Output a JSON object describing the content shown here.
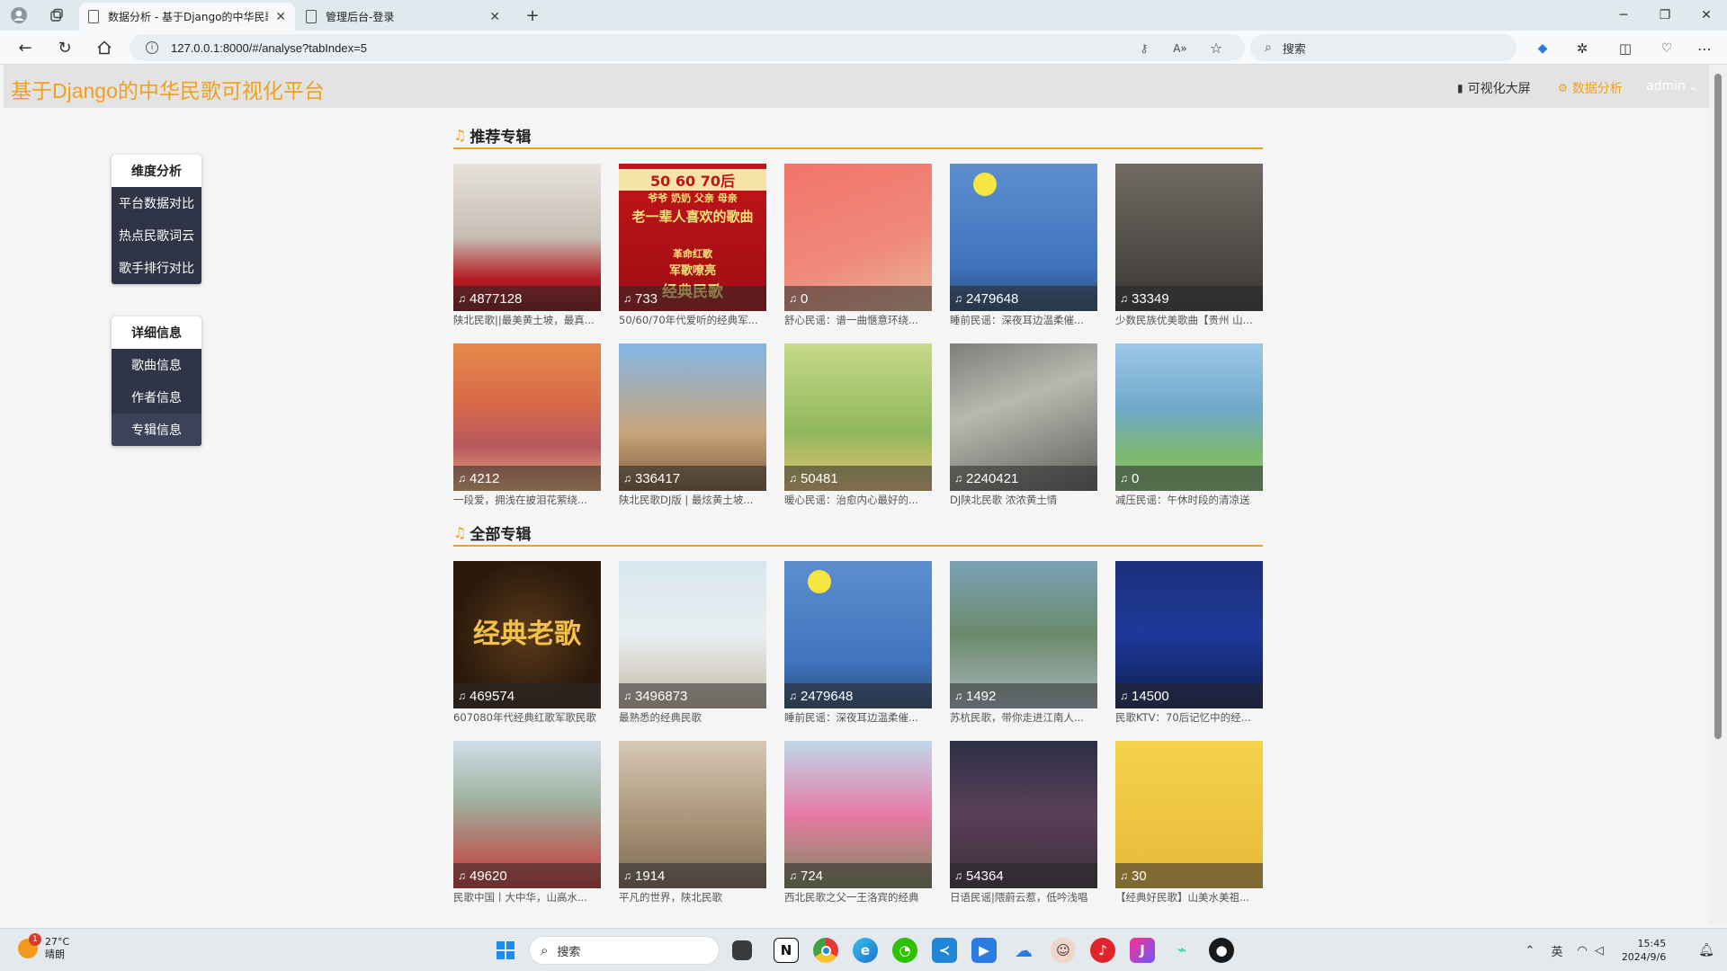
{
  "browser": {
    "tabs": [
      {
        "label": "数据分析 - 基于Django的中华民歌",
        "active": true
      },
      {
        "label": "管理后台-登录",
        "active": false
      }
    ],
    "new_tab": "+",
    "url": "127.0.0.1:8000/#/analyse?tabIndex=5",
    "search_placeholder": "搜索",
    "window_controls": [
      "minimize-icon",
      "restore-icon",
      "close-icon"
    ]
  },
  "header": {
    "site_title": "基于Django的中华民歌可视化平台",
    "links": [
      {
        "label": "可视化大屏",
        "icon": "bar-chart-icon"
      },
      {
        "label": "数据分析",
        "icon": "gear-icon",
        "active": true
      },
      {
        "label": "admin",
        "icon": "chevron-down-icon"
      }
    ]
  },
  "sidebar": {
    "dimension": {
      "title": "维度分析",
      "items": [
        "平台数据对比",
        "热点民歌词云",
        "歌手排行对比"
      ]
    },
    "detail": {
      "title": "详细信息",
      "items": [
        "歌曲信息",
        "作者信息",
        "专辑信息"
      ],
      "active_index": 2
    }
  },
  "sections": {
    "recommended": {
      "title": "推荐专辑",
      "albums": [
        {
          "count": "4877128",
          "title": "陕北民歌||最美黄土坡，最真..."
        },
        {
          "count": "733",
          "title": "50/60/70年代爱听的经典军..."
        },
        {
          "count": "0",
          "title": "舒心民谣：谱一曲惬意环绕..."
        },
        {
          "count": "2479648",
          "title": "睡前民谣：深夜耳边温柔催..."
        },
        {
          "count": "33349",
          "title": "少数民族优美歌曲【贵州 山..."
        },
        {
          "count": "4212",
          "title": "一段爱，拥浅在披泪花萦绕..."
        },
        {
          "count": "336417",
          "title": "陕北民歌DJ版 | 最炫黄土坡..."
        },
        {
          "count": "50481",
          "title": "暖心民谣：治愈内心最好的..."
        },
        {
          "count": "2240421",
          "title": "DJ陕北民歌 浓浓黄土情"
        },
        {
          "count": "0",
          "title": "减压民谣：午休时段的清凉送"
        }
      ]
    },
    "all": {
      "title": "全部专辑",
      "albums": [
        {
          "count": "469574",
          "title": "607080年代经典红歌军歌民歌"
        },
        {
          "count": "3496873",
          "title": "最熟悉的经典民歌"
        },
        {
          "count": "2479648",
          "title": "睡前民谣：深夜耳边温柔催..."
        },
        {
          "count": "1492",
          "title": "苏杭民歌，带你走进江南人..."
        },
        {
          "count": "14500",
          "title": "民歌KTV：70后记忆中的经..."
        },
        {
          "count": "49620",
          "title": "民歌中国丨大中华，山高水..."
        },
        {
          "count": "1914",
          "title": "平凡的世界，陕北民歌"
        },
        {
          "count": "724",
          "title": "西北民歌之父一王洛宾的经典"
        },
        {
          "count": "54364",
          "title": "日语民谣|隈蔚云惹，低吟浅唱"
        },
        {
          "count": "30",
          "title": "【经典好民歌】山美水美祖..."
        }
      ]
    }
  },
  "cover_texts": {
    "r1_line1": "50 60 70后",
    "r1_line2": "爷爷 奶奶 父亲 母亲",
    "r1_line3": "老一辈人喜欢的歌曲",
    "r1_line4": "革命红歌",
    "r1_line5": "军歌嘹亮",
    "r1_line6": "经典民歌",
    "a0_line1": "经典老歌"
  },
  "taskbar": {
    "weather_temp": "27°C",
    "weather_desc": "晴朗",
    "weather_badge": "1",
    "search_placeholder": "搜索",
    "ime": "英",
    "time": "15:45",
    "date": "2024/9/6"
  },
  "colors": {
    "accent": "#f0a020",
    "sidebar_bg": "#2f3446",
    "header_bg": "#e3e3e3"
  }
}
